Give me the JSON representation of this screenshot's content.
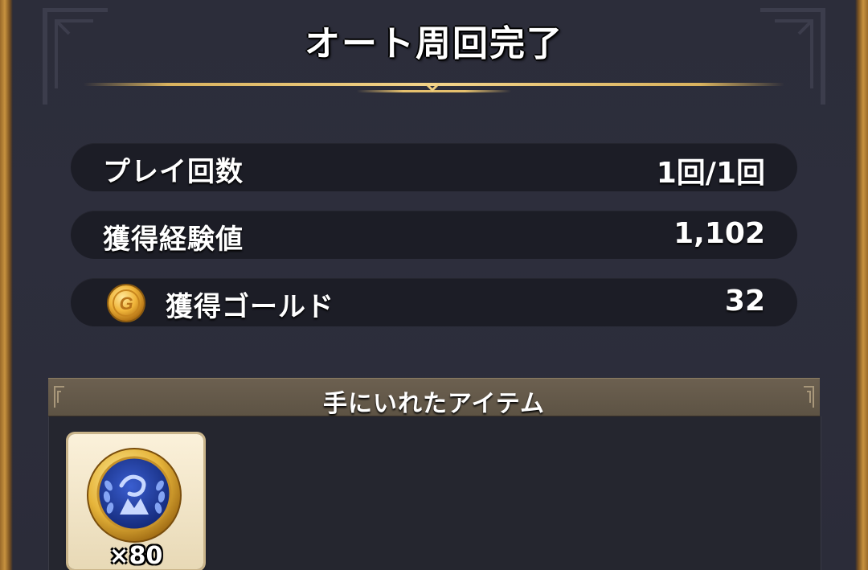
{
  "title": "オート周回完了",
  "stats": [
    {
      "label": "プレイ回数",
      "value": "1回/1回"
    },
    {
      "label": "獲得経験値",
      "value": "1,102"
    },
    {
      "label": "獲得ゴールド",
      "value": "32",
      "icon": "gold-coin-icon"
    }
  ],
  "items_section": {
    "header": "手にいれたアイテム",
    "items": [
      {
        "icon": "blue-medal-icon",
        "quantity": "×80"
      }
    ]
  },
  "colors": {
    "panel": "#2c2d3a",
    "row": "#1c1d26",
    "gold_accent": "#e5c06d",
    "frame": "#c7923f"
  }
}
